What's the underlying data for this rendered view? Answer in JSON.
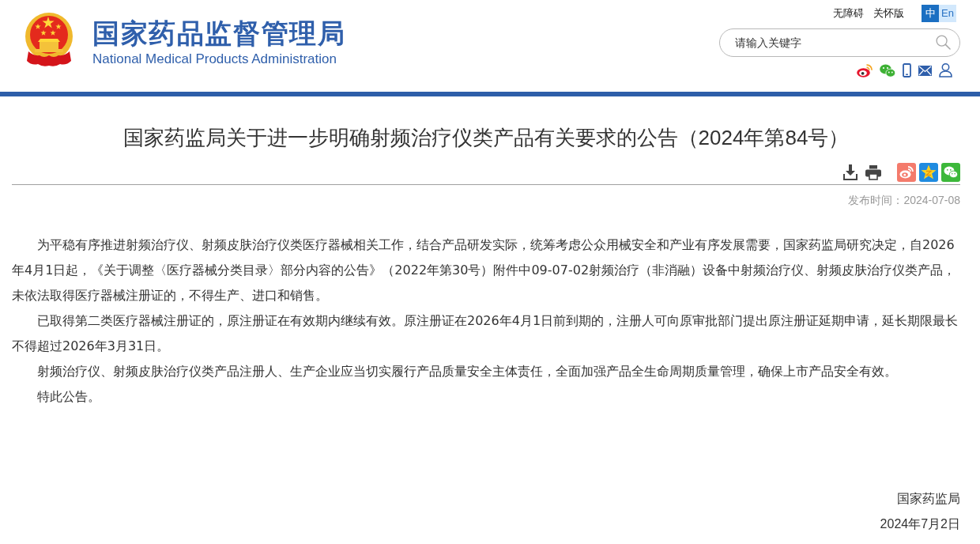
{
  "header": {
    "title": "国家药品监督管理局",
    "subtitle": "National Medical Products Administration",
    "links": [
      "无障碍",
      "关怀版"
    ],
    "languages": [
      {
        "label": "中",
        "selected": true
      },
      {
        "label": "En",
        "selected": false
      }
    ],
    "search": {
      "placeholder": "请输入关键字"
    }
  },
  "article": {
    "title": "国家药监局关于进一步明确射频治疗仪类产品有关要求的公告（2024年第84号）",
    "published": "发布时间：2024-07-08",
    "paragraphs": [
      "为平稳有序推进射频治疗仪、射频皮肤治疗仪类医疗器械相关工作，结合产品研发实际，统筹考虑公众用械安全和产业有序发展需要，国家药监局研究决定，自2026年4月1日起，《关于调整〈医疗器械分类目录〉部分内容的公告》（2022年第30号）附件中09-07-02射频治疗（非消融）设备中射频治疗仪、射频皮肤治疗仪类产品，未依法取得医疗器械注册证的，不得生产、进口和销售。",
      "已取得第二类医疗器械注册证的，原注册证在有效期内继续有效。原注册证在2026年4月1日前到期的，注册人可向原审批部门提出原注册证延期申请，延长期限最长不得超过2026年3月31日。",
      "射频治疗仪、射频皮肤治疗仪类产品注册人、生产企业应当切实履行产品质量安全主体责任，全面加强产品全生命周期质量管理，确保上市产品安全有效。",
      "特此公告。"
    ],
    "signature": "国家药监局",
    "date": "2024年7月2日"
  }
}
